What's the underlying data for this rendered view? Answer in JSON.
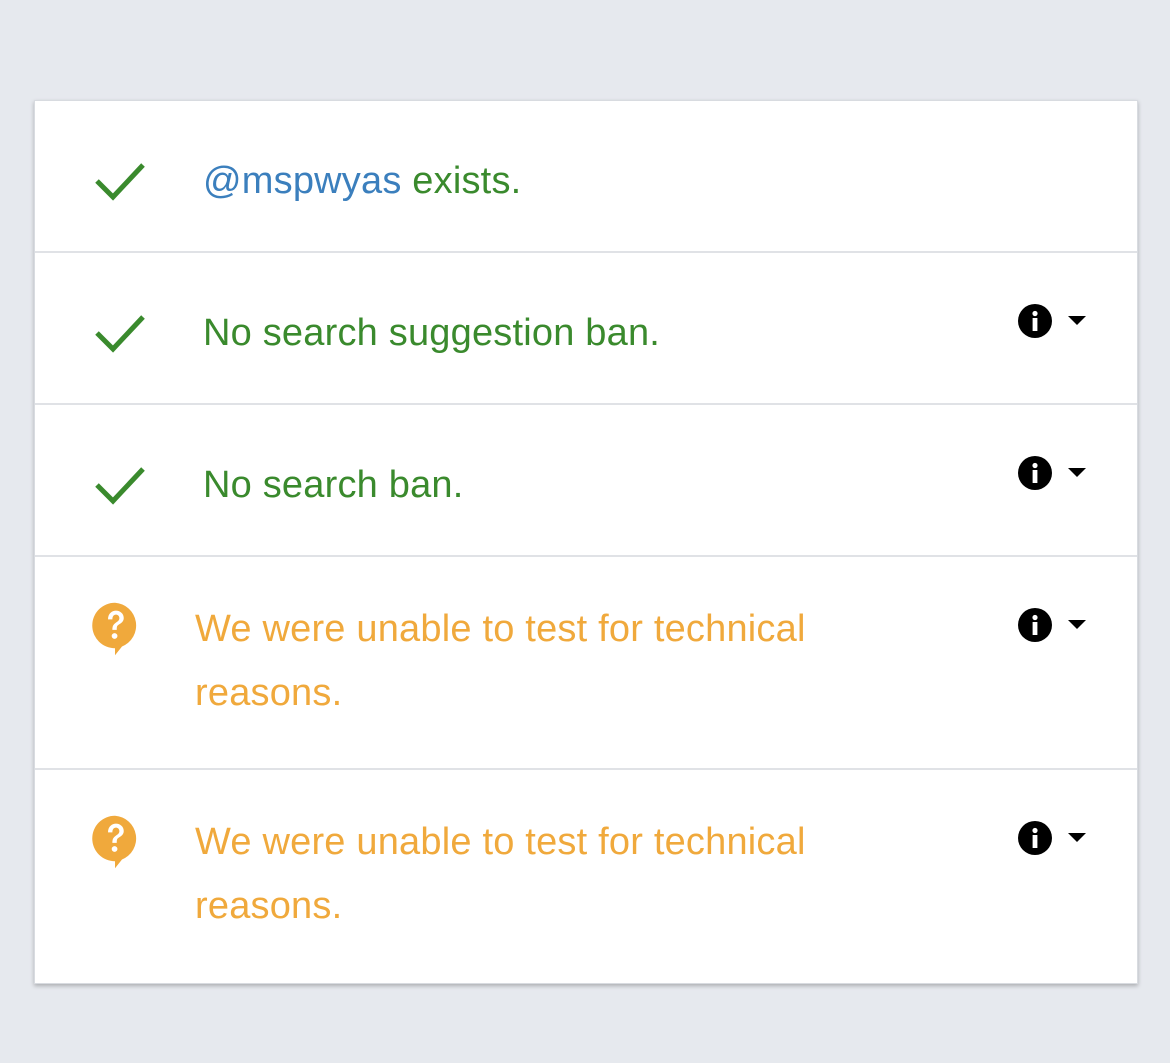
{
  "colors": {
    "success": "#3a8a2d",
    "handle": "#3b7fbd",
    "warning": "#f0a93c",
    "background": "#e6e9ee"
  },
  "rows": [
    {
      "status": "success",
      "icon": "check-icon",
      "handle": "@mspwyas",
      "text": " exists.",
      "has_info": false
    },
    {
      "status": "success",
      "icon": "check-icon",
      "text": "No search suggestion ban.",
      "has_info": true
    },
    {
      "status": "success",
      "icon": "check-icon",
      "text": "No search ban.",
      "has_info": true
    },
    {
      "status": "unknown",
      "icon": "question-bubble-icon",
      "text": "We were unable to test for technical reasons.",
      "has_info": true
    },
    {
      "status": "unknown",
      "icon": "question-bubble-icon",
      "text": "We were unable to test for technical reasons.",
      "has_info": true
    }
  ]
}
